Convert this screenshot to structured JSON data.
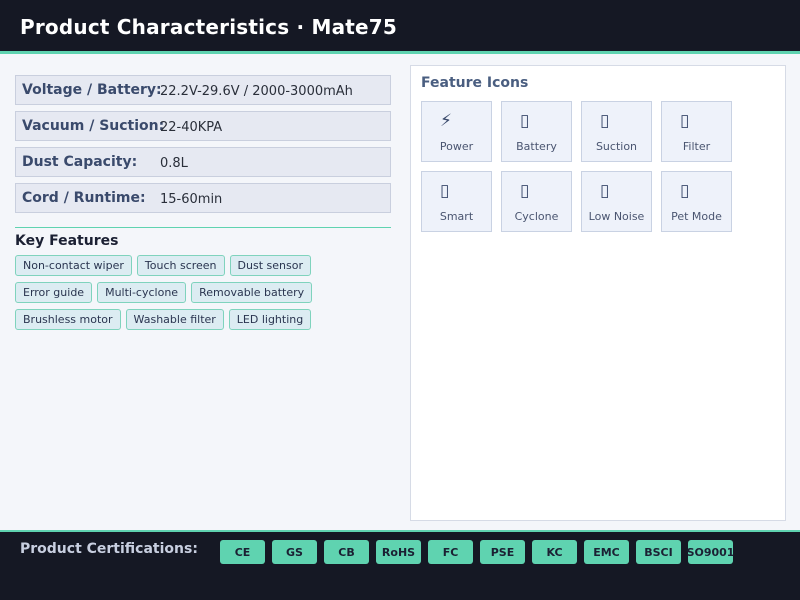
{
  "header": {
    "title": "Product Characteristics  ·  Mate75"
  },
  "specs": [
    {
      "label": "Voltage / Battery:",
      "value": "22.2V-29.6V / 2000-3000mAh"
    },
    {
      "label": "Vacuum / Suction:",
      "value": "22-40KPA"
    },
    {
      "label": "Dust Capacity:",
      "value": "0.8L"
    },
    {
      "label": "Cord / Runtime:",
      "value": "15-60min"
    }
  ],
  "key_features": {
    "title": "Key Features",
    "items": [
      "Non-contact wiper",
      "Touch screen",
      "Dust sensor",
      "Error guide",
      "Multi-cyclone",
      "Removable battery",
      "Brushless motor",
      "Washable filter",
      "LED lighting"
    ]
  },
  "feature_icons": {
    "title": "Feature Icons",
    "items": [
      {
        "label": "Power",
        "icon": "lightning-icon",
        "glyph": "⚡"
      },
      {
        "label": "Battery",
        "icon": "battery-icon",
        "glyph": "▯"
      },
      {
        "label": "Suction",
        "icon": "suction-icon",
        "glyph": "▯"
      },
      {
        "label": "Filter",
        "icon": "filter-icon",
        "glyph": "▯"
      },
      {
        "label": "Smart",
        "icon": "smart-icon",
        "glyph": "▯"
      },
      {
        "label": "Cyclone",
        "icon": "cyclone-icon",
        "glyph": "▯"
      },
      {
        "label": "Low Noise",
        "icon": "low-noise-icon",
        "glyph": "▯"
      },
      {
        "label": "Pet Mode",
        "icon": "pet-mode-icon",
        "glyph": "▯"
      }
    ]
  },
  "certifications": {
    "title": "Product Certifications:",
    "items": [
      "CE",
      "GS",
      "CB",
      "RoHS",
      "FC",
      "PSE",
      "KC",
      "EMC",
      "BSCI",
      "SO9001"
    ]
  },
  "colors": {
    "header_bg": "#151824",
    "accent": "#5fd3b0",
    "spec_bg": "#e6e9f2"
  }
}
